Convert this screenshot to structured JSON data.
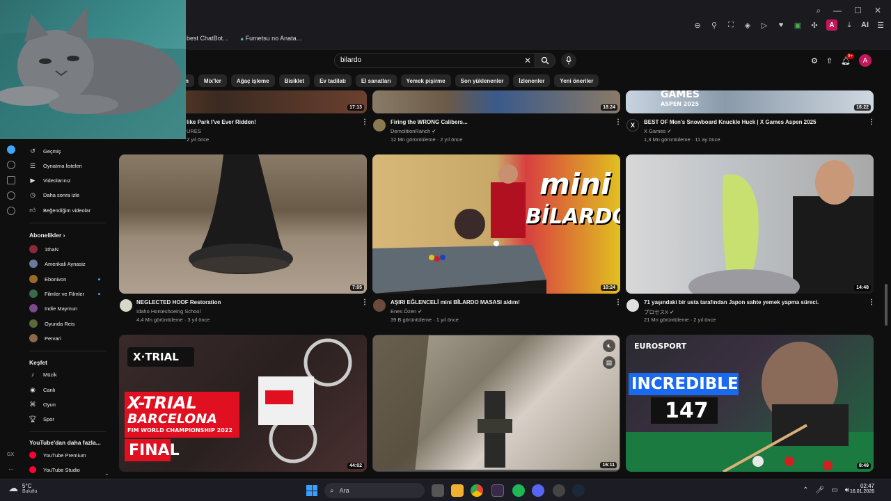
{
  "browser": {
    "bookmarks": [
      "best ChatBot...",
      "Fumetsu no Anata..."
    ],
    "ai_label": "AI",
    "avatar_letter": "A"
  },
  "search": {
    "query": "bilardo"
  },
  "header": {
    "notif_count": "9+",
    "avatar_letter": "A"
  },
  "chips": [
    "n",
    "Mix'ler",
    "Ağaç işleme",
    "Bisiklet",
    "Ev tadilatı",
    "El sanatları",
    "Yemek pişirme",
    "Son yüklenenler",
    "İzlenenler",
    "Yeni öneriler"
  ],
  "sidebar": {
    "you_items": [
      "Geçmiş",
      "Oynatma listeleri",
      "Videolarınız",
      "Daha sonra izle",
      "Beğendiğim videolar"
    ],
    "subs_title": "Abonelikler",
    "subs": [
      "1thaN",
      "Amerikali Aynasiz",
      "Ebonivon",
      "Filmler ve Filmler",
      "Indie Maymun",
      "Oyunda Reis",
      "Pervari"
    ],
    "explore_title": "Keşfet",
    "explore": [
      "Müzik",
      "Canlı",
      "Oyun",
      "Spor"
    ],
    "more_title": "YouTube'dan daha fazla...",
    "more": [
      "YouTube Premium",
      "YouTube Studio"
    ],
    "gx_label": "GX"
  },
  "videos_row1": [
    {
      "title": "like Park I've Ever Ridden!",
      "channel": "URES",
      "meta": "2 yıl önce",
      "duration": "17:13"
    },
    {
      "title": "Firing the WRONG Calibers...",
      "channel": "DemolitionRanch",
      "meta": "12 Mn görüntüleme · 2 yıl önce",
      "duration": "18:24"
    },
    {
      "title": "BEST OF Men's Snowboard Knuckle Huck | X Games Aspen 2025",
      "channel": "X Games",
      "meta": "1,3 Mn görüntüleme · 11 ay önce",
      "duration": "16:22"
    }
  ],
  "videos_row2": [
    {
      "title": "NEGLECTED HOOF Restoration",
      "channel": "Idaho Horseshoeing School",
      "meta": "4,4 Mn görüntüleme · 3 yıl önce",
      "duration": "7:05"
    },
    {
      "title": "AŞIRI EĞLENCELİ mini BİLARDO MASASI aldım!",
      "channel": "Enes Özen",
      "meta": "39 B görüntüleme · 1 yıl önce",
      "duration": "10:24"
    },
    {
      "title": "71 yaşındaki bir usta tarafından Japon sahte yemek yapma süreci.",
      "channel": "プロセスX",
      "meta": "21 Mn görüntüleme · 2 yıl önce",
      "duration": "14:48"
    }
  ],
  "videos_row3": [
    {
      "duration": "44:02"
    },
    {
      "duration": "16:11"
    },
    {
      "duration": "8:49"
    }
  ],
  "thumb_texts": {
    "xgames": "GAMES",
    "xgames_sub": "ASPEN 2025",
    "mini": "mini",
    "bilardo": "BİLARDO",
    "xtrial_logo": "X·TRIAL",
    "xtrial_line1": "X-TRIAL",
    "xtrial_line2": "BARCELONA",
    "xtrial_line3": "FIM WORLD CHAMPIONSHIP 2022",
    "xtrial_final": "FINAL",
    "eurosport": "EUROSPORT",
    "incredible": "INCREDIBLE",
    "score": "147"
  },
  "taskbar": {
    "temp": "5°C",
    "weather": "Bulutlu",
    "search": "Ara",
    "time": "02:47",
    "date": "16.01.2026"
  },
  "colors": {
    "accent": "#3ea6ff",
    "brand_red": "#ff0000",
    "avatar": "#c2185b"
  }
}
